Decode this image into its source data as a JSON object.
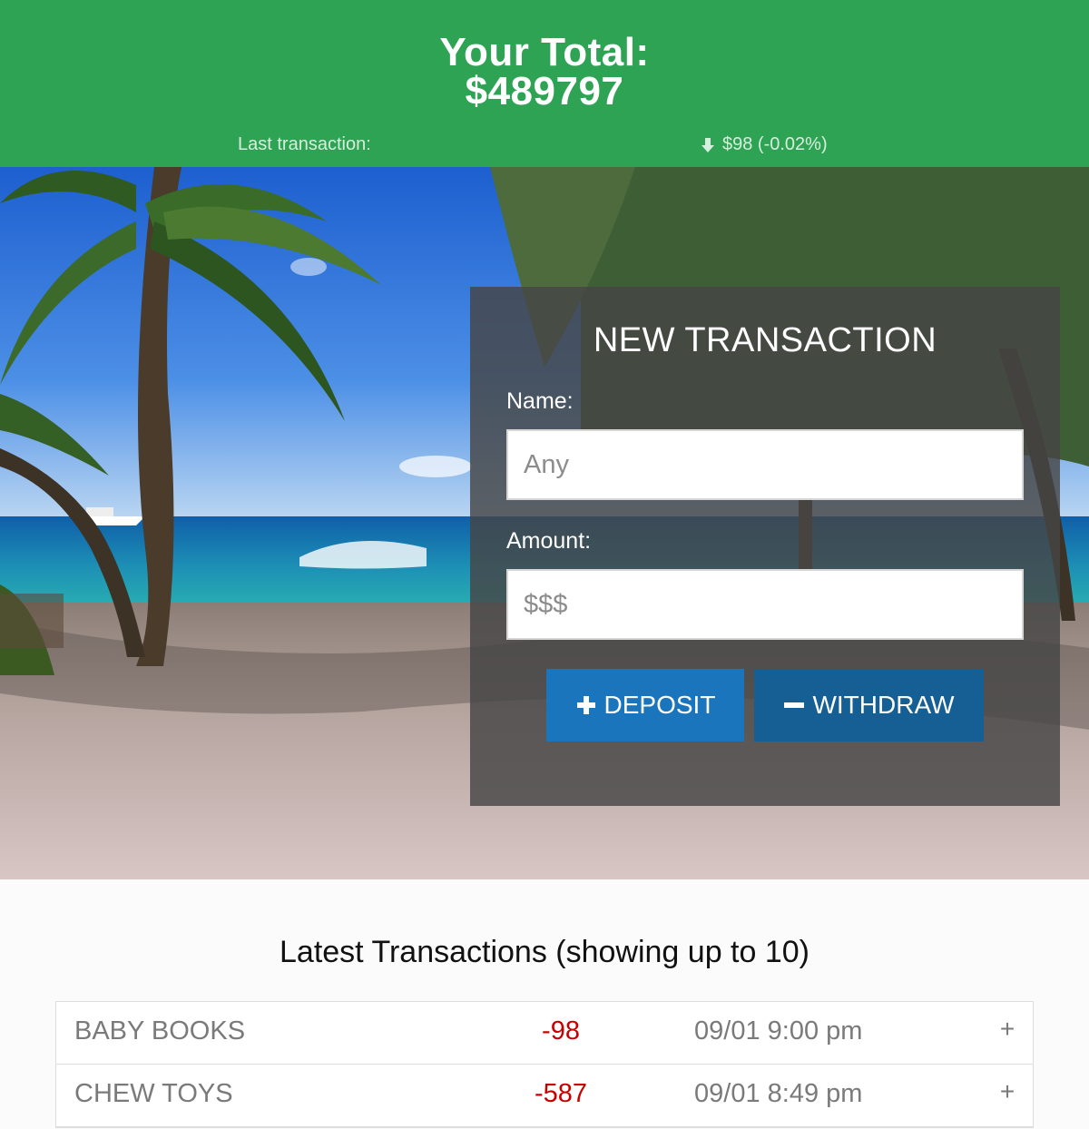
{
  "header": {
    "total_label": "Your Total:",
    "total_value": "$489797",
    "last_transaction_label": "Last transaction:",
    "last_transaction_change": "$98 (-0.02%)",
    "last_transaction_icon": "arrow-down-icon"
  },
  "form": {
    "title": "NEW TRANSACTION",
    "name_label": "Name:",
    "name_placeholder": "Any",
    "name_value": "",
    "amount_label": "Amount:",
    "amount_placeholder": "$$$",
    "amount_value": "",
    "deposit_label": "DEPOSIT",
    "deposit_icon": "plus-icon",
    "withdraw_label": "WITHDRAW",
    "withdraw_icon": "minus-icon"
  },
  "transactions": {
    "title": "Latest Transactions (showing up to 10)",
    "rows": [
      {
        "name": "BABY BOOKS",
        "amount": "-98",
        "date": "09/01 9:00 pm",
        "expand": "+"
      },
      {
        "name": "CHEW TOYS",
        "amount": "-587",
        "date": "09/01 8:49 pm",
        "expand": "+"
      }
    ]
  },
  "colors": {
    "header_bg": "#2ea354",
    "deposit_button": "#1a75bc",
    "withdraw_button": "#155f95",
    "negative_amount": "#c80000"
  }
}
